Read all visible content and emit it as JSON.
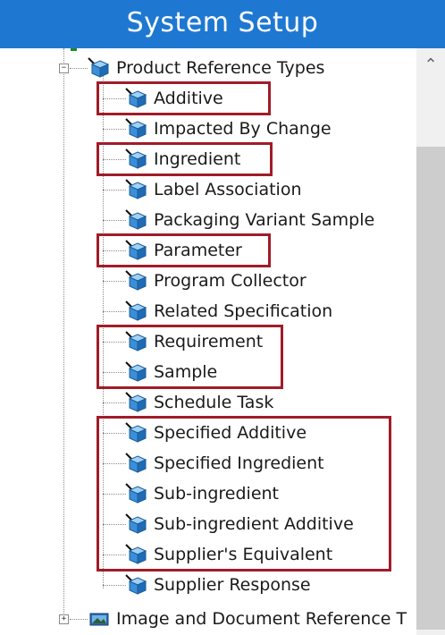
{
  "window": {
    "title": "System Setup"
  },
  "tree": {
    "parent": {
      "label": "Product Reference Types",
      "expander": "−"
    },
    "children": [
      {
        "label": "Additive",
        "highlighted": true
      },
      {
        "label": "Impacted By Change",
        "highlighted": false
      },
      {
        "label": "Ingredient",
        "highlighted": true
      },
      {
        "label": "Label Association",
        "highlighted": false
      },
      {
        "label": "Packaging Variant Sample",
        "highlighted": false
      },
      {
        "label": "Parameter",
        "highlighted": true
      },
      {
        "label": "Program Collector",
        "highlighted": false
      },
      {
        "label": "Related Specification",
        "highlighted": false
      },
      {
        "label": "Requirement",
        "highlighted": true
      },
      {
        "label": "Sample",
        "highlighted": true
      },
      {
        "label": "Schedule Task",
        "highlighted": false
      },
      {
        "label": "Specified Additive",
        "highlighted": true
      },
      {
        "label": "Specified Ingredient",
        "highlighted": true
      },
      {
        "label": "Sub-ingredient",
        "highlighted": true
      },
      {
        "label": "Sub-ingredient Additive",
        "highlighted": true
      },
      {
        "label": "Supplier's Equivalent",
        "highlighted": true
      },
      {
        "label": "Supplier Response",
        "highlighted": false
      }
    ],
    "next_sibling": {
      "label": "Image and Document Reference T",
      "expander": "+"
    }
  },
  "scrollbar": {
    "up_arrow": "⌃"
  },
  "colors": {
    "titlebar": "#1e78d2",
    "highlight": "#a01c28",
    "icon_blue": "#3a8fd8"
  }
}
